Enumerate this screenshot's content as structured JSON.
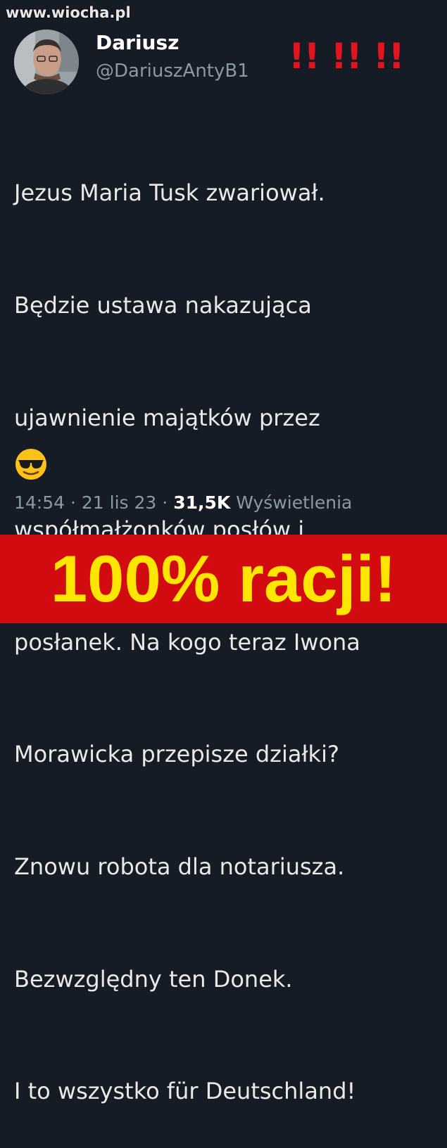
{
  "watermark": "www.wiocha.pl",
  "author": {
    "name": "Dariusz",
    "handle": "@DariuszAntyB1"
  },
  "exclamation": "!! !! !!",
  "tweet": {
    "lines": [
      "Jezus Maria Tusk zwariował.",
      "Będzie ustawa nakazująca",
      "ujawnienie majątków przez",
      "współmałżonków posłów i",
      "posłanek. Na kogo teraz Iwona",
      "Morawicka przepisze działki?",
      "Znowu robota dla notariusza.",
      "Bezwzględny ten Donek.",
      "I to wszystko für Deutschland!"
    ],
    "emoji_icon": "sunglasses-emoji-icon",
    "time": "14:54",
    "date": "21 lis 23",
    "views_count": "31,5K",
    "views_label": "Wyświetlenia",
    "separator": "·"
  },
  "banner": {
    "text": "100% racji!",
    "background": "#d10b10",
    "text_color": "#ffe600"
  },
  "colors": {
    "background": "#161c25",
    "text": "#e7e9ea",
    "muted": "#8b98a5",
    "alert": "#e3141e"
  }
}
